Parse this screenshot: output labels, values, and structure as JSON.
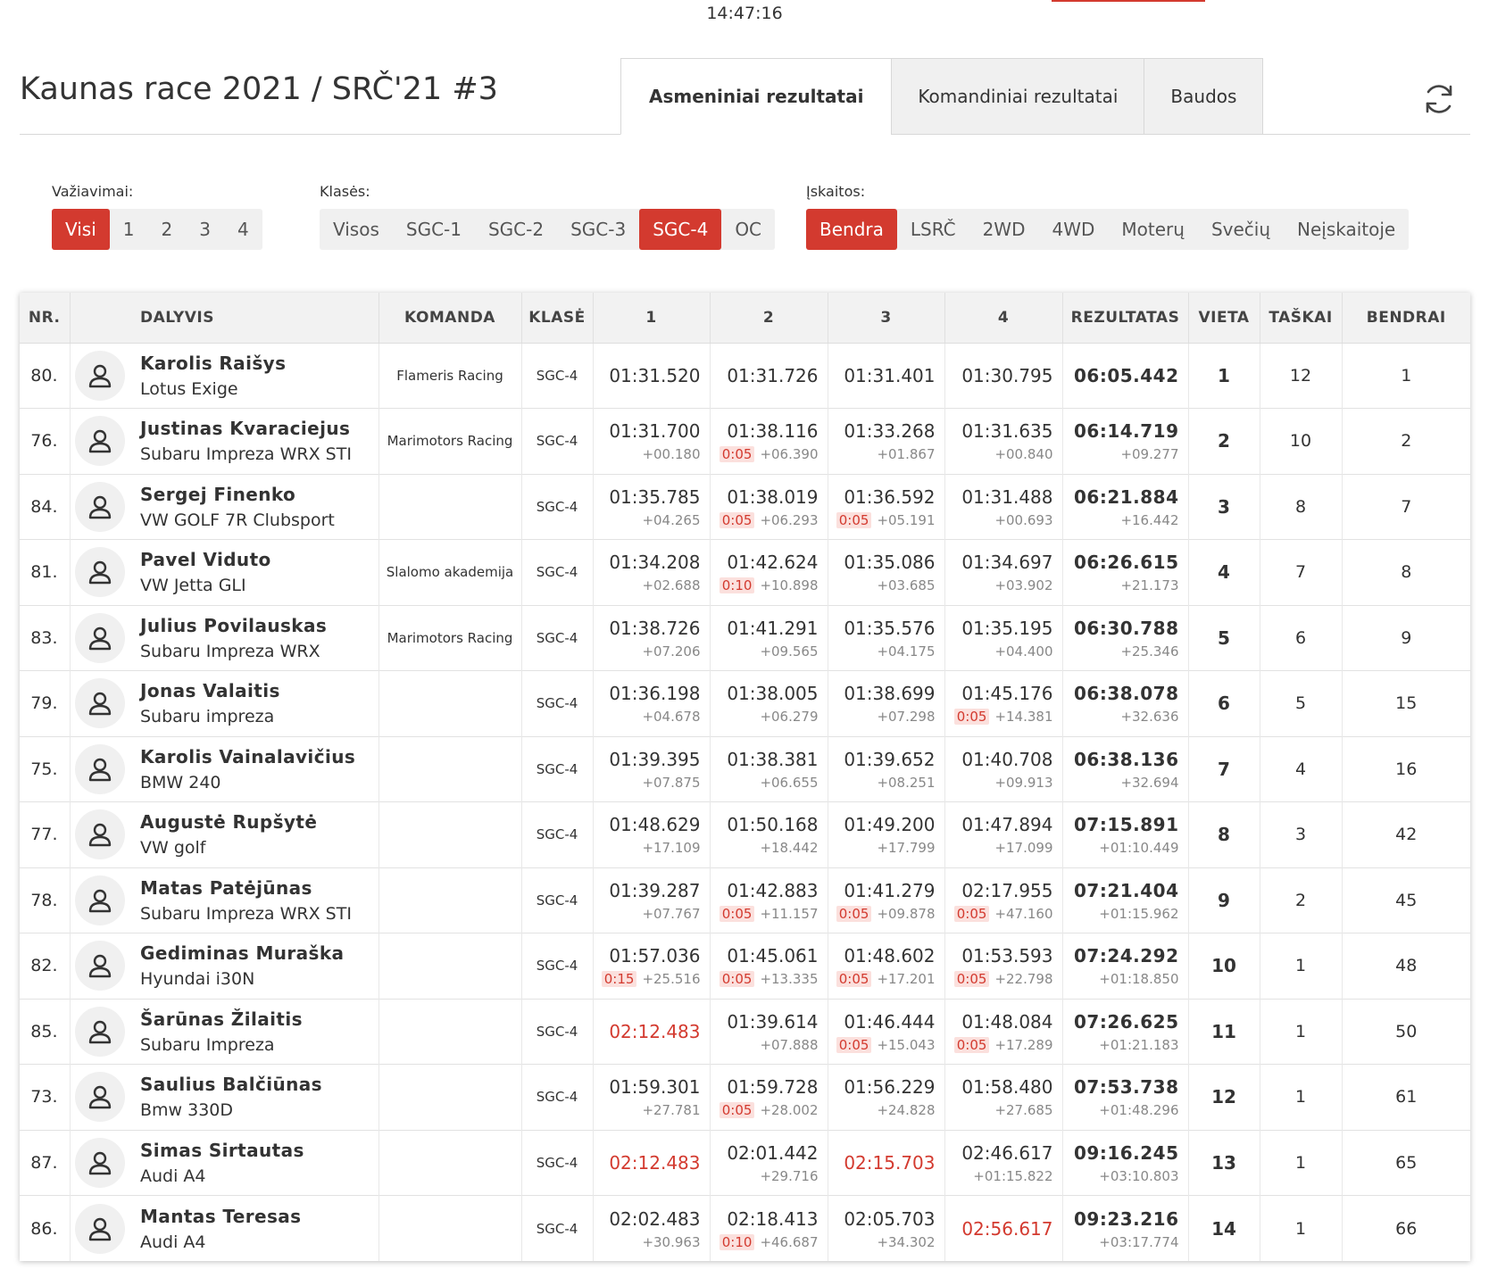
{
  "clock": "14:47:16",
  "title": "Kaunas race 2021 / SRČ'21 #3",
  "tabs": [
    {
      "label": "Asmeniniai rezultatai",
      "active": true
    },
    {
      "label": "Komandiniai rezultatai",
      "active": false
    },
    {
      "label": "Baudos",
      "active": false
    }
  ],
  "refresh_icon": "refresh-icon",
  "filters": {
    "runs": {
      "label": "Važiavimai:",
      "options": [
        "Visi",
        "1",
        "2",
        "3",
        "4"
      ],
      "active": 0
    },
    "classes": {
      "label": "Klasės:",
      "options": [
        "Visos",
        "SGC-1",
        "SGC-2",
        "SGC-3",
        "SGC-4",
        "OC"
      ],
      "active": 4
    },
    "standings": {
      "label": "Įskaitos:",
      "options": [
        "Bendra",
        "LSRČ",
        "2WD",
        "4WD",
        "Moterų",
        "Svečių",
        "Neįskaitoje"
      ],
      "active": 0
    }
  },
  "colors": {
    "accent": "#d33a2f",
    "penalty_bg": "#fbe0dd"
  },
  "table": {
    "headers": [
      "NR.",
      "DALYVIS",
      "KOMANDA",
      "KLASĖ",
      "1",
      "2",
      "3",
      "4",
      "REZULTATAS",
      "VIETA",
      "TAŠKAI",
      "BENDRAI"
    ],
    "rows": [
      {
        "nr": "80.",
        "name": "Karolis Raišys",
        "car": "Lotus Exige",
        "team": "Flameris Racing",
        "class": "SGC-4",
        "runs": [
          {
            "time": "01:31.520"
          },
          {
            "time": "01:31.726"
          },
          {
            "time": "01:31.401"
          },
          {
            "time": "01:30.795"
          }
        ],
        "result": "06:05.442",
        "result_diff": "",
        "place": "1",
        "points": "12",
        "overall": "1"
      },
      {
        "nr": "76.",
        "name": "Justinas Kvaraciejus",
        "car": "Subaru Impreza WRX STI",
        "team": "Marimotors Racing",
        "class": "SGC-4",
        "runs": [
          {
            "time": "01:31.700",
            "diff": "+00.180"
          },
          {
            "time": "01:38.116",
            "penalty": "0:05",
            "diff": "+06.390"
          },
          {
            "time": "01:33.268",
            "diff": "+01.867"
          },
          {
            "time": "01:31.635",
            "diff": "+00.840"
          }
        ],
        "result": "06:14.719",
        "result_diff": "+09.277",
        "place": "2",
        "points": "10",
        "overall": "2"
      },
      {
        "nr": "84.",
        "name": "Sergej Finenko",
        "car": "VW GOLF 7R Clubsport",
        "team": "",
        "class": "SGC-4",
        "runs": [
          {
            "time": "01:35.785",
            "diff": "+04.265"
          },
          {
            "time": "01:38.019",
            "penalty": "0:05",
            "diff": "+06.293"
          },
          {
            "time": "01:36.592",
            "penalty": "0:05",
            "diff": "+05.191"
          },
          {
            "time": "01:31.488",
            "diff": "+00.693"
          }
        ],
        "result": "06:21.884",
        "result_diff": "+16.442",
        "place": "3",
        "points": "8",
        "overall": "7"
      },
      {
        "nr": "81.",
        "name": "Pavel Viduto",
        "car": "VW Jetta GLI",
        "team": "Slalomo akademija",
        "class": "SGC-4",
        "runs": [
          {
            "time": "01:34.208",
            "diff": "+02.688"
          },
          {
            "time": "01:42.624",
            "penalty": "0:10",
            "diff": "+10.898"
          },
          {
            "time": "01:35.086",
            "diff": "+03.685"
          },
          {
            "time": "01:34.697",
            "diff": "+03.902"
          }
        ],
        "result": "06:26.615",
        "result_diff": "+21.173",
        "place": "4",
        "points": "7",
        "overall": "8"
      },
      {
        "nr": "83.",
        "name": "Julius Povilauskas",
        "car": "Subaru Impreza WRX",
        "team": "Marimotors Racing",
        "class": "SGC-4",
        "runs": [
          {
            "time": "01:38.726",
            "diff": "+07.206"
          },
          {
            "time": "01:41.291",
            "diff": "+09.565"
          },
          {
            "time": "01:35.576",
            "diff": "+04.175"
          },
          {
            "time": "01:35.195",
            "diff": "+04.400"
          }
        ],
        "result": "06:30.788",
        "result_diff": "+25.346",
        "place": "5",
        "points": "6",
        "overall": "9"
      },
      {
        "nr": "79.",
        "name": "Jonas Valaitis",
        "car": "Subaru impreza",
        "team": "",
        "class": "SGC-4",
        "runs": [
          {
            "time": "01:36.198",
            "diff": "+04.678"
          },
          {
            "time": "01:38.005",
            "diff": "+06.279"
          },
          {
            "time": "01:38.699",
            "diff": "+07.298"
          },
          {
            "time": "01:45.176",
            "penalty": "0:05",
            "diff": "+14.381"
          }
        ],
        "result": "06:38.078",
        "result_diff": "+32.636",
        "place": "6",
        "points": "5",
        "overall": "15"
      },
      {
        "nr": "75.",
        "name": "Karolis Vainalavičius",
        "car": "BMW 240",
        "team": "",
        "class": "SGC-4",
        "runs": [
          {
            "time": "01:39.395",
            "diff": "+07.875"
          },
          {
            "time": "01:38.381",
            "diff": "+06.655"
          },
          {
            "time": "01:39.652",
            "diff": "+08.251"
          },
          {
            "time": "01:40.708",
            "diff": "+09.913"
          }
        ],
        "result": "06:38.136",
        "result_diff": "+32.694",
        "place": "7",
        "points": "4",
        "overall": "16"
      },
      {
        "nr": "77.",
        "name": "Augustė Rupšytė",
        "car": "VW golf",
        "team": "",
        "class": "SGC-4",
        "runs": [
          {
            "time": "01:48.629",
            "diff": "+17.109"
          },
          {
            "time": "01:50.168",
            "diff": "+18.442"
          },
          {
            "time": "01:49.200",
            "diff": "+17.799"
          },
          {
            "time": "01:47.894",
            "diff": "+17.099"
          }
        ],
        "result": "07:15.891",
        "result_diff": "+01:10.449",
        "place": "8",
        "points": "3",
        "overall": "42"
      },
      {
        "nr": "78.",
        "name": "Matas Patėjūnas",
        "car": "Subaru Impreza WRX STI",
        "team": "",
        "class": "SGC-4",
        "runs": [
          {
            "time": "01:39.287",
            "diff": "+07.767"
          },
          {
            "time": "01:42.883",
            "penalty": "0:05",
            "diff": "+11.157"
          },
          {
            "time": "01:41.279",
            "penalty": "0:05",
            "diff": "+09.878"
          },
          {
            "time": "02:17.955",
            "penalty": "0:05",
            "diff": "+47.160"
          }
        ],
        "result": "07:21.404",
        "result_diff": "+01:15.962",
        "place": "9",
        "points": "2",
        "overall": "45"
      },
      {
        "nr": "82.",
        "name": "Gediminas Muraška",
        "car": "Hyundai i30N",
        "team": "",
        "class": "SGC-4",
        "runs": [
          {
            "time": "01:57.036",
            "penalty": "0:15",
            "diff": "+25.516"
          },
          {
            "time": "01:45.061",
            "penalty": "0:05",
            "diff": "+13.335"
          },
          {
            "time": "01:48.602",
            "penalty": "0:05",
            "diff": "+17.201"
          },
          {
            "time": "01:53.593",
            "penalty": "0:05",
            "diff": "+22.798"
          }
        ],
        "result": "07:24.292",
        "result_diff": "+01:18.850",
        "place": "10",
        "points": "1",
        "overall": "48"
      },
      {
        "nr": "85.",
        "name": "Šarūnas Žilaitis",
        "car": "Subaru Impreza",
        "team": "",
        "class": "SGC-4",
        "runs": [
          {
            "time": "02:12.483",
            "red": true
          },
          {
            "time": "01:39.614",
            "diff": "+07.888"
          },
          {
            "time": "01:46.444",
            "penalty": "0:05",
            "diff": "+15.043"
          },
          {
            "time": "01:48.084",
            "penalty": "0:05",
            "diff": "+17.289"
          }
        ],
        "result": "07:26.625",
        "result_diff": "+01:21.183",
        "place": "11",
        "points": "1",
        "overall": "50"
      },
      {
        "nr": "73.",
        "name": "Saulius Balčiūnas",
        "car": "Bmw 330D",
        "team": "",
        "class": "SGC-4",
        "runs": [
          {
            "time": "01:59.301",
            "diff": "+27.781"
          },
          {
            "time": "01:59.728",
            "penalty": "0:05",
            "diff": "+28.002"
          },
          {
            "time": "01:56.229",
            "diff": "+24.828"
          },
          {
            "time": "01:58.480",
            "diff": "+27.685"
          }
        ],
        "result": "07:53.738",
        "result_diff": "+01:48.296",
        "place": "12",
        "points": "1",
        "overall": "61"
      },
      {
        "nr": "87.",
        "name": "Simas Sirtautas",
        "car": "Audi A4",
        "team": "",
        "class": "SGC-4",
        "runs": [
          {
            "time": "02:12.483",
            "red": true
          },
          {
            "time": "02:01.442",
            "diff": "+29.716"
          },
          {
            "time": "02:15.703",
            "red": true
          },
          {
            "time": "02:46.617",
            "diff": "+01:15.822"
          }
        ],
        "result": "09:16.245",
        "result_diff": "+03:10.803",
        "place": "13",
        "points": "1",
        "overall": "65"
      },
      {
        "nr": "86.",
        "name": "Mantas Teresas",
        "car": "Audi A4",
        "team": "",
        "class": "SGC-4",
        "runs": [
          {
            "time": "02:02.483",
            "diff": "+30.963"
          },
          {
            "time": "02:18.413",
            "penalty": "0:10",
            "diff": "+46.687"
          },
          {
            "time": "02:05.703",
            "diff": "+34.302"
          },
          {
            "time": "02:56.617",
            "red": true
          }
        ],
        "result": "09:23.216",
        "result_diff": "+03:17.774",
        "place": "14",
        "points": "1",
        "overall": "66"
      }
    ]
  }
}
